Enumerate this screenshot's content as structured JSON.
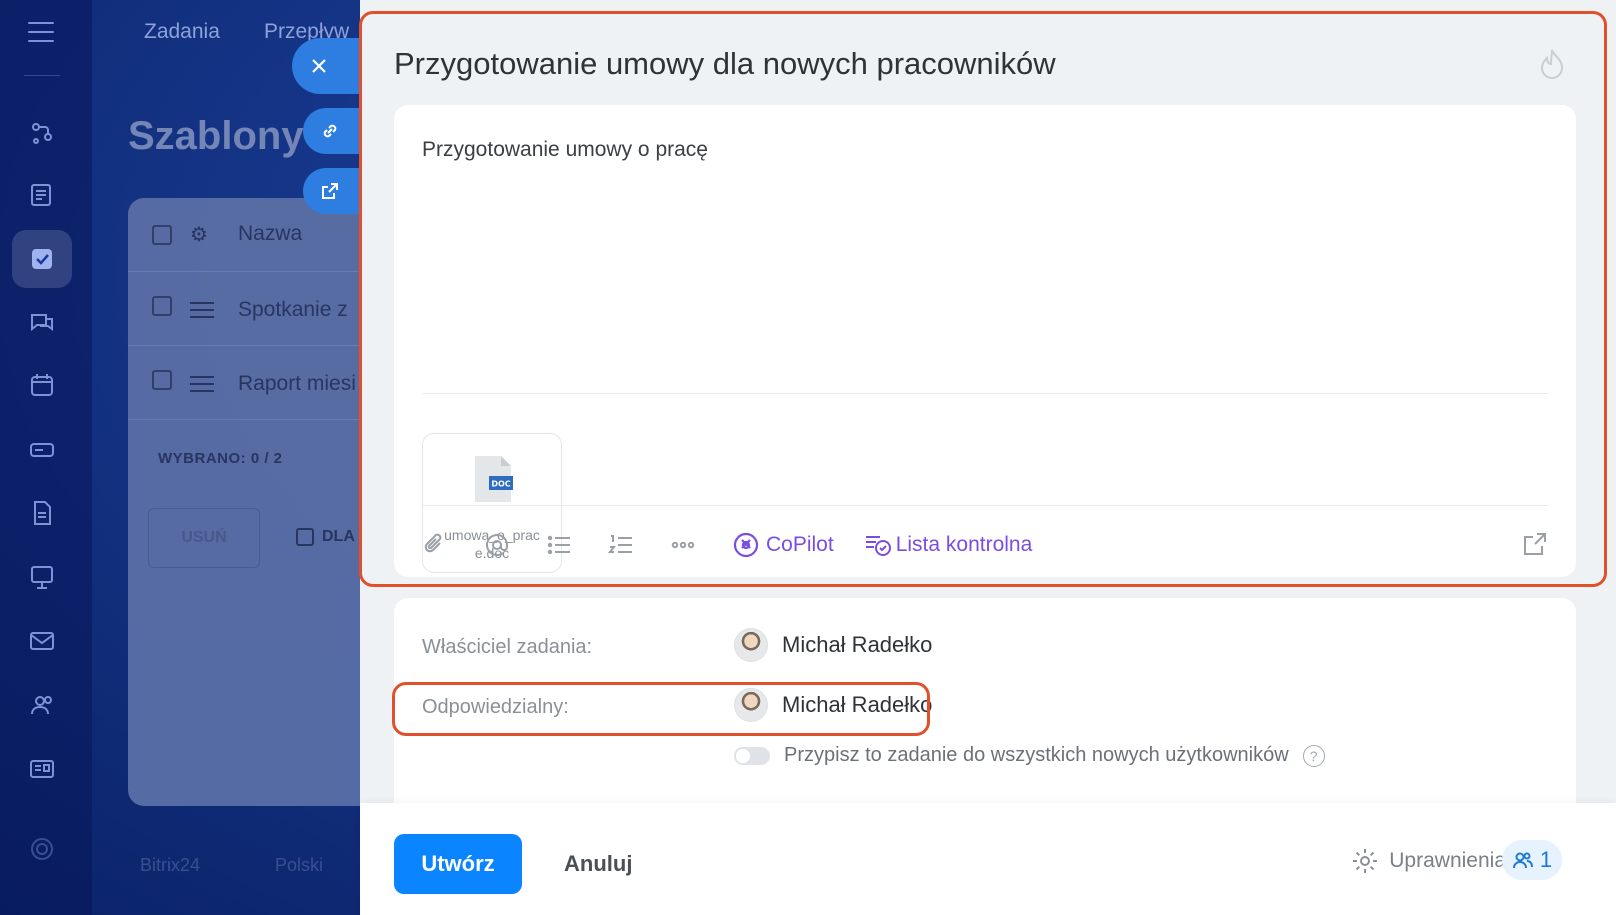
{
  "background_app": {
    "nav_links": [
      "Zadania",
      "Przepływ"
    ],
    "page_title": "Szablony z",
    "grid": {
      "header_label": "Nazwa",
      "rows": [
        "Spotkanie z",
        "Raport miesi"
      ],
      "selected_text": "WYBRANO: 0 / 2",
      "delete_label": "USUŃ",
      "for_all_label": "DLA"
    },
    "footer": [
      "Bitrix24",
      "Polski"
    ]
  },
  "slider": {
    "title": "Przygotowanie umowy dla nowych pracowników",
    "editor": {
      "text": "Przygotowanie umowy o pracę",
      "attachment": {
        "badge": "DOC",
        "name": "umowa_o_prac",
        "ext": "e.doc"
      },
      "toolbar": {
        "copilot_label": "CoPilot",
        "checklist_label": "Lista kontrolna"
      }
    },
    "fields": {
      "owner_label": "Właściciel zadania:",
      "owner_name": "Michał Radełko",
      "responsible_label": "Odpowiedzialny:",
      "responsible_name": "Michał Radełko",
      "assign_all_label": "Przypisz to zadanie do wszystkich nowych użytkowników",
      "help": "?"
    },
    "footer": {
      "create_label": "Utwórz",
      "cancel_label": "Anuluj",
      "permissions_label": "Uprawnienia",
      "permissions_count": "1"
    }
  },
  "colors": {
    "accent": "#0a84ff",
    "copilot": "#7a4de0",
    "highlight": "#e0502a",
    "side_button": "#2e7de0"
  }
}
